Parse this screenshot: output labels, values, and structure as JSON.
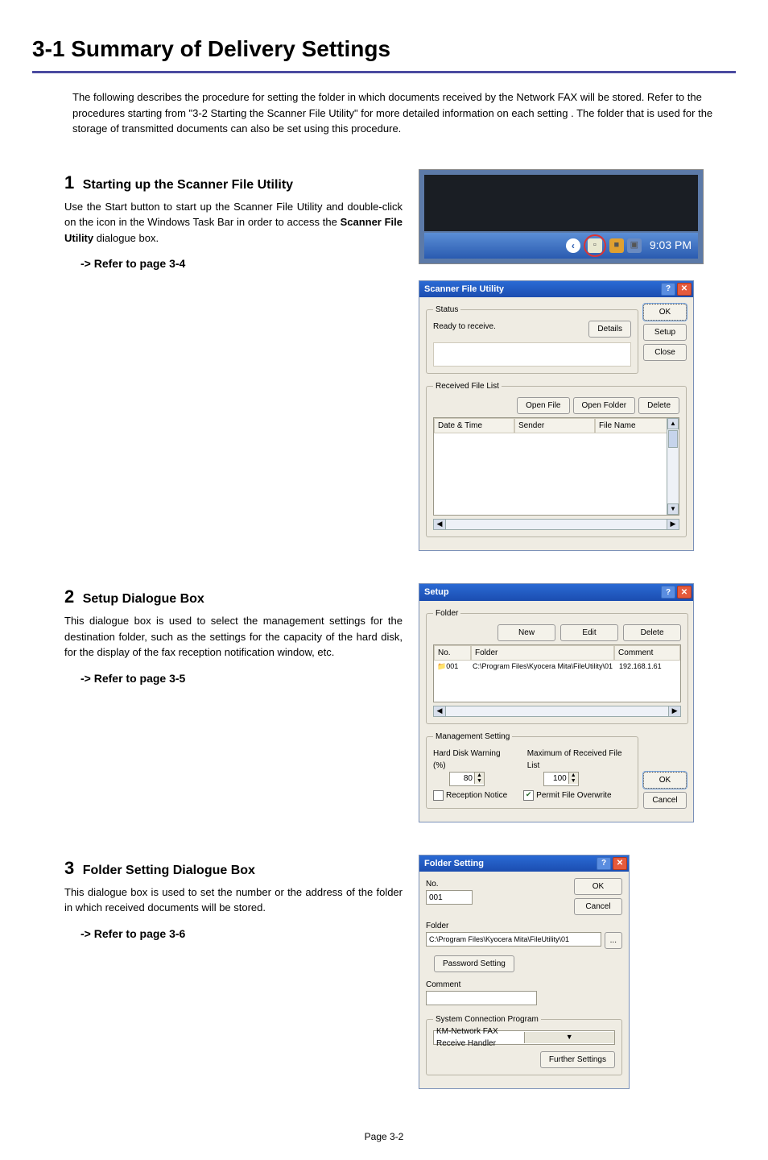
{
  "page_title": "3-1  Summary of Delivery Settings",
  "intro": "The following describes the procedure for setting the folder in which documents received by the Network FAX will be stored. Refer to the procedures starting from \"3-2 Starting the Scanner File Utility\" for more detailed information on each setting . The folder that is used for the storage of transmitted documents can also be set using this procedure.",
  "step1": {
    "num": "1",
    "title": "Starting up the Scanner File Utility",
    "body_pre": "Use the Start button to start up the Scanner File Utility and double-click on the icon in the Windows Task Bar in order to access the ",
    "body_bold": "Scanner File Utility",
    "body_post": " dialogue box.",
    "refer": "-> Refer to page 3-4"
  },
  "step2": {
    "num": "2",
    "title": "Setup Dialogue Box",
    "body": "This dialogue box is used to select the management settings for the destination folder, such as the settings for the capacity of the hard disk, for the display of the fax reception notification window, etc.",
    "refer": "-> Refer to page 3-5"
  },
  "step3": {
    "num": "3",
    "title": "Folder Setting Dialogue Box",
    "body": "This dialogue box is used to set the number or the address of the folder in which received documents will be stored.",
    "refer": "-> Refer to page 3-6"
  },
  "taskbar": {
    "time": "9:03 PM"
  },
  "sfu": {
    "title": "Scanner File Utility",
    "status_legend": "Status",
    "status_text": "Ready to receive.",
    "details": "Details",
    "ok": "OK",
    "setup": "Setup",
    "close": "Close",
    "rfl_legend": "Received File List",
    "open_file": "Open File",
    "open_folder": "Open Folder",
    "delete": "Delete",
    "col_date": "Date & Time",
    "col_sender": "Sender",
    "col_file": "File Name"
  },
  "setup": {
    "title": "Setup",
    "folder_legend": "Folder",
    "new": "New",
    "edit": "Edit",
    "delete": "Delete",
    "col_no": "No.",
    "col_folder": "Folder",
    "col_comment": "Comment",
    "row_no": "001",
    "row_folder": "C:\\Program Files\\Kyocera Mita\\FileUtility\\01",
    "row_comment": "192.168.1.61",
    "mgmt_legend": "Management Setting",
    "hdw": "Hard Disk Warning (%)",
    "hdw_val": "80",
    "max_rfl": "Maximum of Received File List",
    "max_val": "100",
    "recnotice": "Reception Notice",
    "permit": "Permit File Overwrite",
    "ok": "OK",
    "cancel": "Cancel"
  },
  "fs": {
    "title": "Folder Setting",
    "no_label": "No.",
    "no_val": "001",
    "ok": "OK",
    "cancel": "Cancel",
    "folder_label": "Folder",
    "folder_val": "C:\\Program Files\\Kyocera Mita\\FileUtility\\01",
    "browse": "...",
    "pwd": "Password Setting",
    "comment_label": "Comment",
    "comment_val": "",
    "scp_legend": "System Connection Program",
    "scp_val": "KM-Network FAX Receive Handler",
    "further": "Further Settings"
  },
  "footer": "Page 3-2"
}
